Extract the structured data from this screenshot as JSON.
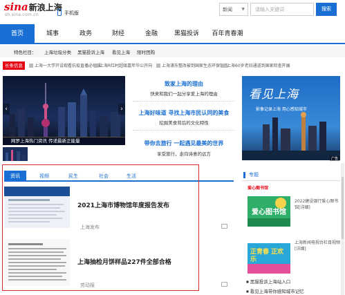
{
  "header": {
    "logo_text": "sina",
    "site_name": "新浪上海",
    "site_url": "sh.sina.com.cn",
    "mobile_label": "手机版",
    "search": {
      "category": "新闻",
      "placeholder": "请输入关键词",
      "button": "搜索"
    }
  },
  "nav": {
    "items": [
      {
        "label": "首页",
        "active": true
      },
      {
        "label": "城事"
      },
      {
        "label": "政务"
      },
      {
        "label": "财经"
      },
      {
        "label": "金融"
      },
      {
        "label": "黑猫投诉"
      },
      {
        "label": "百年青春潮"
      }
    ]
  },
  "special": {
    "label": "特色栏目：",
    "links": [
      "上海垃圾分类",
      "黑猫投诉上海",
      "看见上海",
      "限时团购"
    ]
  },
  "ticker": {
    "tag": "长条信息",
    "items": [
      "上海一大学开设观看抗疫直播必修课",
      "上海R红村超级嘉年华公开向",
      "上海浦东整改被到国家生态环保督查",
      "上海60岁老旧通道到国家检查开展"
    ]
  },
  "hero": {
    "caption": "网罗上海热门资讯 传递最新正能量",
    "prev": "‹",
    "next": "›"
  },
  "features": [
    {
      "title": "致家上海的理由",
      "sub": "快来和我们一起分享爱上海的理由"
    },
    {
      "title": "上海好味道 寻找上海市民认同的美食",
      "sub": "挖掘美食背后的文化特性"
    },
    {
      "title": "带你去旅行 一起遇见最美的世界",
      "sub": "享受旅行，走向诗意的远方"
    }
  ],
  "ad": {
    "headline": "看见上海",
    "subline": "影像记录上海  用心感知城市",
    "badge": "广告"
  },
  "tabs": {
    "items": [
      {
        "label": "资讯",
        "active": true
      },
      {
        "label": "视频"
      },
      {
        "label": "民生"
      },
      {
        "label": "社会"
      },
      {
        "label": "生活"
      }
    ]
  },
  "news": [
    {
      "title": "2021上海市博物馆年度报告发布",
      "source": "上海发布"
    },
    {
      "title": "上海抽检月饼样品227件全部合格",
      "source": "劳动报"
    }
  ],
  "side": {
    "header": "专题",
    "sub_label": "爱心图书馆",
    "items": [
      {
        "text": "2022建设银行爱心图书馆[详细]",
        "img_text": "爱心图书馆"
      },
      {
        "text": "上海新闻电视台栏目视频[详细]",
        "img_text": "正青春 正欢乐"
      }
    ],
    "links": [
      "黑猫投诉上海站入口",
      "看见上海带你感知城市记忆"
    ]
  },
  "colors": {
    "accent": "#1a6fd4",
    "brand_red": "#e60012",
    "highlight_box": "#d62a2a"
  }
}
